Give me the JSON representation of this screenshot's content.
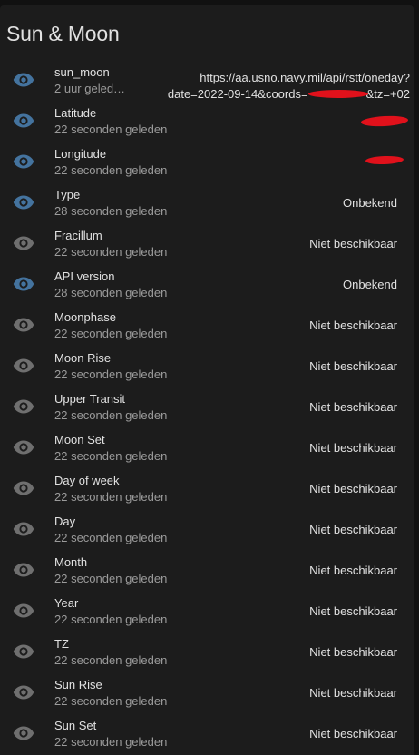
{
  "card": {
    "title": "Sun & Moon"
  },
  "colors": {
    "eye_active": "#44739e",
    "eye_inactive": "#6f6f6f",
    "redaction": "#e0111b"
  },
  "entities": [
    {
      "name": "sun_moon",
      "time": "2 uur geled…",
      "value_line1": "https://aa.usno.navy.mil/api/rstt/oneday?",
      "value_line2_a": "date=2022-09-14&coords=",
      "value_line2_b": "&tz=+02",
      "icon": "eye-icon",
      "active": true
    },
    {
      "name": "Latitude",
      "time": "22 seconden geleden",
      "value": "",
      "icon": "eye-icon",
      "active": true
    },
    {
      "name": "Longitude",
      "time": "22 seconden geleden",
      "value": "",
      "icon": "eye-icon",
      "active": true
    },
    {
      "name": "Type",
      "time": "28 seconden geleden",
      "value": "Onbekend",
      "icon": "eye-icon",
      "active": true
    },
    {
      "name": "Fracillum",
      "time": "22 seconden geleden",
      "value": "Niet beschikbaar",
      "icon": "eye-icon",
      "active": false
    },
    {
      "name": "API version",
      "time": "28 seconden geleden",
      "value": "Onbekend",
      "icon": "eye-icon",
      "active": true
    },
    {
      "name": "Moonphase",
      "time": "22 seconden geleden",
      "value": "Niet beschikbaar",
      "icon": "eye-icon",
      "active": false
    },
    {
      "name": "Moon Rise",
      "time": "22 seconden geleden",
      "value": "Niet beschikbaar",
      "icon": "eye-icon",
      "active": false
    },
    {
      "name": "Upper Transit",
      "time": "22 seconden geleden",
      "value": "Niet beschikbaar",
      "icon": "eye-icon",
      "active": false
    },
    {
      "name": "Moon Set",
      "time": "22 seconden geleden",
      "value": "Niet beschikbaar",
      "icon": "eye-icon",
      "active": false
    },
    {
      "name": "Day of week",
      "time": "22 seconden geleden",
      "value": "Niet beschikbaar",
      "icon": "eye-icon",
      "active": false
    },
    {
      "name": "Day",
      "time": "22 seconden geleden",
      "value": "Niet beschikbaar",
      "icon": "eye-icon",
      "active": false
    },
    {
      "name": "Month",
      "time": "22 seconden geleden",
      "value": "Niet beschikbaar",
      "icon": "eye-icon",
      "active": false
    },
    {
      "name": "Year",
      "time": "22 seconden geleden",
      "value": "Niet beschikbaar",
      "icon": "eye-icon",
      "active": false
    },
    {
      "name": "TZ",
      "time": "22 seconden geleden",
      "value": "Niet beschikbaar",
      "icon": "eye-icon",
      "active": false
    },
    {
      "name": "Sun Rise",
      "time": "22 seconden geleden",
      "value": "Niet beschikbaar",
      "icon": "eye-icon",
      "active": false
    },
    {
      "name": "Sun Set",
      "time": "22 seconden geleden",
      "value": "Niet beschikbaar",
      "icon": "eye-icon",
      "active": false
    }
  ]
}
